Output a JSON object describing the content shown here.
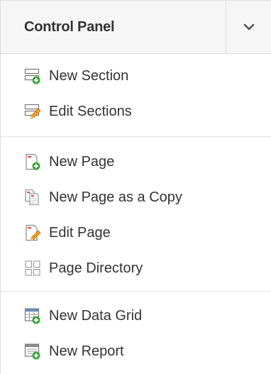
{
  "panel": {
    "title": "Control Panel",
    "toggle_icon": "chevron-down-icon"
  },
  "sections": [
    {
      "items": [
        {
          "label": "New Section",
          "icon": "new-section-icon"
        },
        {
          "label": "Edit Sections",
          "icon": "edit-sections-icon"
        }
      ]
    },
    {
      "items": [
        {
          "label": "New Page",
          "icon": "new-page-icon"
        },
        {
          "label": "New Page as a Copy",
          "icon": "copy-page-icon"
        },
        {
          "label": "Edit Page",
          "icon": "edit-page-icon"
        },
        {
          "label": "Page Directory",
          "icon": "page-directory-icon"
        }
      ]
    },
    {
      "items": [
        {
          "label": "New Data Grid",
          "icon": "new-data-grid-icon"
        },
        {
          "label": "New Report",
          "icon": "new-report-icon"
        }
      ]
    }
  ],
  "colors": {
    "header_bg": "#f6f6f6",
    "border": "#dddddd",
    "text": "#333333",
    "plus_green": "#3aa63a",
    "pencil_orange": "#f0a020",
    "page_red": "#d9443a"
  }
}
